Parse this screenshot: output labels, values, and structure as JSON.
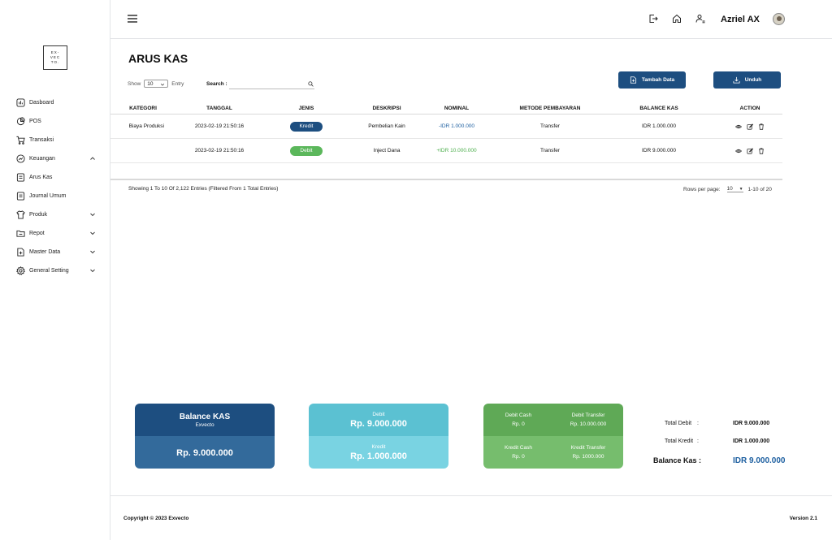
{
  "logo": {
    "lines": [
      "EX-",
      "VEC",
      "TO."
    ]
  },
  "sidebar": {
    "items": [
      {
        "label": "Dasboard"
      },
      {
        "label": "POS"
      },
      {
        "label": "Transaksi"
      },
      {
        "label": "Keuangan"
      },
      {
        "label": "Arus Kas"
      },
      {
        "label": "Journal Umum"
      },
      {
        "label": "Produk"
      },
      {
        "label": "Repot"
      },
      {
        "label": "Master Data"
      },
      {
        "label": "General Setting"
      }
    ]
  },
  "header": {
    "username": "Azriel AX"
  },
  "page": {
    "title": "ARUS KAS",
    "show_label": "Show",
    "show_value": "10",
    "entry_label": "Entry",
    "search_label": "Search :",
    "search_value": "",
    "btn_add": "Tambah Data",
    "btn_download": "Unduh"
  },
  "table": {
    "headers": [
      "KATEGORI",
      "TANGGAL",
      "JENIS",
      "DESKRIPSI",
      "NOMINAL",
      "METODE PEMBAYARAN",
      "BALANCE KAS",
      "ACTION"
    ],
    "rows": [
      {
        "kategori": "Biaya Produksi",
        "tanggal": "2023-02-19 21:50:16",
        "jenis": "Kredit",
        "deskripsi": "Pembelian Kain",
        "nominal": "-IDR 1.000.000",
        "metode": "Transfer",
        "balance": "IDR 1.000.000"
      },
      {
        "kategori": "",
        "tanggal": "2023-02-19 21:50:16",
        "jenis": "Debit",
        "deskripsi": "Inject Dana",
        "nominal": "+IDR 10.000.000",
        "metode": "Transfer",
        "balance": "IDR 9.000.000"
      }
    ],
    "showing": "Showing 1 To 10 Of 2,122 Entries (Filtered From 1 Total Entries)",
    "rows_per_page_label": "Rows per page:",
    "rows_per_page_value": "10",
    "range": "1-10 of 20"
  },
  "cards": {
    "balance": {
      "title": "Balance KAS",
      "subtitle": "Exvecto",
      "value": "Rp. 9.000.000"
    },
    "debit": {
      "label": "Debit",
      "value": "Rp. 9.000.000"
    },
    "kredit": {
      "label": "Kredit",
      "value": "Rp. 1.000.000"
    },
    "methods": {
      "debit_cash_label": "Debit Cash",
      "debit_cash_value": "Rp. 0",
      "debit_transfer_label": "Debit Transfer",
      "debit_transfer_value": "Rp. 10.000.000",
      "kredit_cash_label": "Kredit Cash",
      "kredit_cash_value": "Rp. 0",
      "kredit_transfer_label": "Kredit Transfer",
      "kredit_transfer_value": "Rp. 1000.000"
    }
  },
  "summary": {
    "total_debit_label": "Total Debit",
    "total_debit_value": "IDR 9.000.000",
    "total_kredit_label": "Total Kredit",
    "total_kredit_value": "IDR 1.000.000",
    "balance_label": "Balance Kas :",
    "balance_value": "IDR 9.000.000"
  },
  "footer": {
    "copyright": "Copyright © 2023 Exvecto",
    "version": "Version 2.1"
  },
  "colors": {
    "primary": "#1d4e80",
    "kredit_pill": "#1d4e80",
    "debit_pill": "#5bb75b",
    "negative_text": "#1d5fa0",
    "positive_text": "#4cae4c",
    "balance_card_top": "#1d4e80",
    "balance_card_bottom": "#336a9b",
    "debit_card_top": "#5bc1d2",
    "debit_card_bottom": "#79d3e2",
    "method_card_top": "#5fa956",
    "method_card_bottom": "#76bd6d"
  }
}
